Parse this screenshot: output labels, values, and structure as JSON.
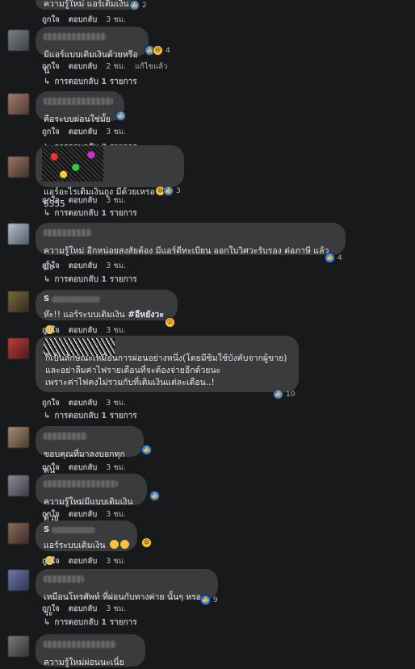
{
  "labels": {
    "like": "ถูกใจ",
    "reply": "ตอบกลับ",
    "edited": "แก้ไขแล้ว"
  },
  "comments": [
    {
      "text": "ความรู้ใหม่ แอร์เติมเงิน",
      "time": "3 ชม.",
      "reactions": "2"
    },
    {
      "text": "มีแอร์แบบเติมเงินด้วยหรือนี่",
      "time": "2 ชม.",
      "reactions": "4",
      "replies": "การตอบกลับ 1 รายการ"
    },
    {
      "text": "คือระบบผ่อนใช่มั้ย",
      "time": "3 ชม.",
      "replies": "การตอบกลับ 3 รายการ"
    },
    {
      "text": "แอร์อะไรเติมเงินถูง มีด้วยเหรอ 5555",
      "time": "3 ชม.",
      "reactions": "3",
      "replies": "การตอบกลับ 1 รายการ"
    },
    {
      "text": "ความรู้ใหม่ อีกหน่อยสงสัยต้อง มีแอร์ดีทะเบียน ออกใบวิศวะรับรอง ต่อภาษี แล้วมั้ง",
      "time": "3 ชม.",
      "reactions": "4",
      "replies": "การตอบกลับ 1 รายการ"
    },
    {
      "name": "S",
      "text_pre": "ห๊ะ!! แอร์ระบบเติมเงิน ",
      "hashtag": "#อีหยังวะ",
      "time": "3 ชม."
    },
    {
      "text": "ก็เป็นลักษณะเหมือนการผ่อนอย่างหนึ่ง(โดยมีซิมใช้บังคับจากผู้ขาย)\nและอย่าลืมค่าไฟรายเดือนที่จะต้องจ่ายอีกด้วยนะ\nเพราะค่าไฟคงไม่รวมกับที่เติมเงินแต่ละเดือน..!",
      "time": "3 ชม.",
      "reactions": "10",
      "replies": "การตอบกลับ 1 รายการ"
    },
    {
      "text": "ขอบคุณที่มาลงบอกทุกคน",
      "time": "3 ชม."
    },
    {
      "text": "ความรู้ใหม่มีแบบเติมเงินด้วย",
      "time": "3 ชม."
    },
    {
      "name": "S",
      "text": "แอร์ระบบเติมเงิน",
      "time": "3 ชม."
    },
    {
      "text": "เหมือนโทรศัพท์ ที่ผ่อนกับทางค่าย นั้นๆ หรอว่ะ",
      "time": "3 ชม.",
      "reactions": "9",
      "replies": "การตอบกลับ 1 รายการ"
    },
    {
      "text": "ความรู้ใหม่ผ่อนนะเนี่ย"
    }
  ],
  "colors": {
    "bg": "#18191a",
    "bubble": "#3a3b3c",
    "meta": "#b0b3b8",
    "like": "#2d88ff",
    "emoji": "#f7c33b"
  }
}
